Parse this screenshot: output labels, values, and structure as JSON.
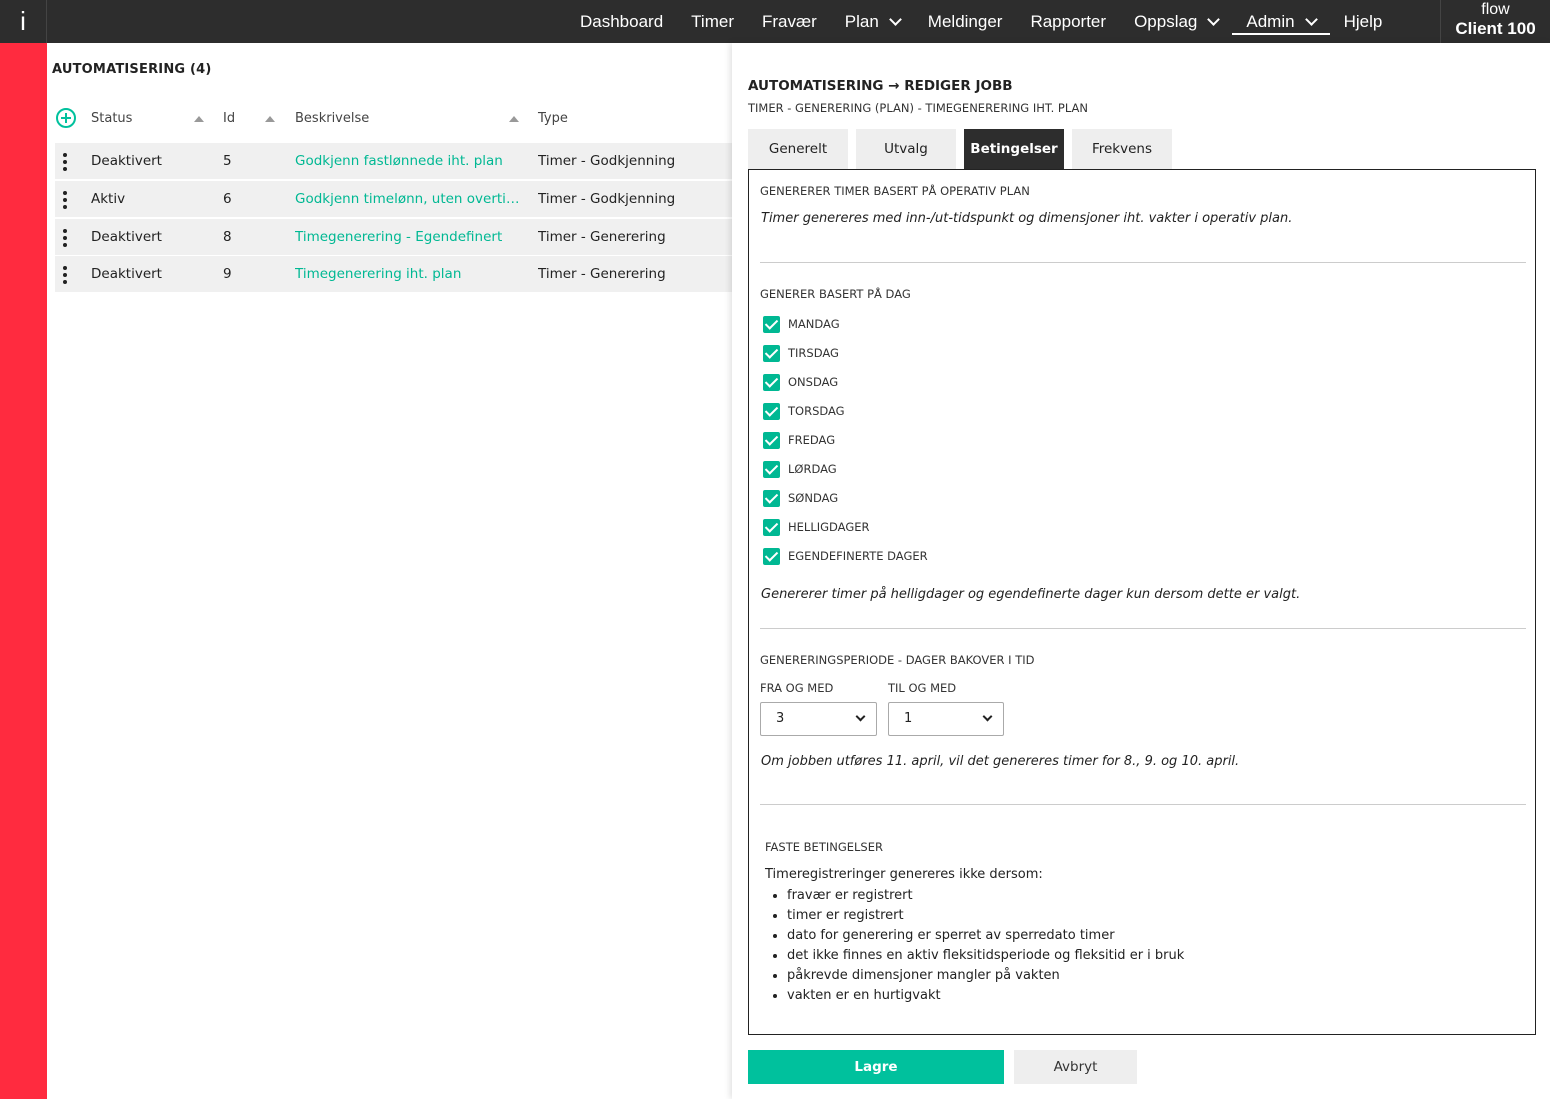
{
  "topbar": {
    "logo": "i",
    "nav": [
      {
        "label": "Dashboard"
      },
      {
        "label": "Timer"
      },
      {
        "label": "Fravær"
      },
      {
        "label": "Plan"
      },
      {
        "label": "Meldinger"
      },
      {
        "label": "Rapporter"
      },
      {
        "label": "Oppslag"
      },
      {
        "label": "Admin"
      },
      {
        "label": "Hjelp"
      }
    ],
    "client_top": "flow",
    "client_name": "Client 100"
  },
  "list": {
    "title": "AUTOMATISERING (4)",
    "columns": {
      "status": "Status",
      "id": "Id",
      "description": "Beskrivelse",
      "type": "Type"
    },
    "rows": [
      {
        "status": "Deaktivert",
        "id": "5",
        "description": "Godkjenn fastlønnede iht. plan",
        "type": "Timer - Godkjenning"
      },
      {
        "status": "Aktiv",
        "id": "6",
        "description": "Godkjenn timelønn, uten overtid el...",
        "type": "Timer - Godkjenning"
      },
      {
        "status": "Deaktivert",
        "id": "8",
        "description": "Timegenerering - Egendefinert",
        "type": "Timer - Generering"
      },
      {
        "status": "Deaktivert",
        "id": "9",
        "description": "Timegenerering iht. plan",
        "type": "Timer - Generering"
      }
    ]
  },
  "panel": {
    "title": "AUTOMATISERING → REDIGER JOBB",
    "subtitle": "TIMER - GENERERING (PLAN) - TIMEGENERERING IHT. PLAN",
    "tabs": [
      {
        "label": "Generelt"
      },
      {
        "label": "Utvalg"
      },
      {
        "label": "Betingelser"
      },
      {
        "label": "Frekvens"
      }
    ],
    "section1": {
      "heading": "GENERERER TIMER BASERT PÅ OPERATIV PLAN",
      "note": "Timer genereres med inn-/ut-tidspunkt og dimensjoner iht. vakter i operativ plan."
    },
    "section2": {
      "heading": "GENERER BASERT PÅ DAG",
      "days": [
        {
          "label": "MANDAG"
        },
        {
          "label": "TIRSDAG"
        },
        {
          "label": "ONSDAG"
        },
        {
          "label": "TORSDAG"
        },
        {
          "label": "FREDAG"
        },
        {
          "label": "LØRDAG"
        },
        {
          "label": "SØNDAG"
        },
        {
          "label": "HELLIGDAGER"
        },
        {
          "label": "EGENDEFINERTE DAGER"
        }
      ],
      "note": "Genererer timer på helligdager og egendefinerte dager kun dersom dette er valgt."
    },
    "section3": {
      "heading": "GENERERINGSPERIODE - DAGER BAKOVER I TID",
      "from_label": "FRA OG MED",
      "from_value": "3",
      "to_label": "TIL OG MED",
      "to_value": "1",
      "note": "Om jobben utføres 11. april, vil det genereres timer for 8., 9. og 10. april."
    },
    "section4": {
      "heading": "FASTE BETINGELSER",
      "intro": "Timeregistreringer genereres ikke dersom:",
      "items": [
        "fravær er registrert",
        "timer er registrert",
        "dato for generering er sperret av sperredato timer",
        "det ikke finnes en aktiv fleksitidsperiode og fleksitid er i bruk",
        "påkrevde dimensjoner mangler på vakten",
        "vakten er en hurtigvakt"
      ]
    },
    "save_label": "Lagre",
    "cancel_label": "Avbryt"
  },
  "colors": {
    "accent": "#00c19d",
    "link": "#00b893",
    "sidebar_red": "#ff2b3f",
    "topbar": "#2d2d2d"
  }
}
